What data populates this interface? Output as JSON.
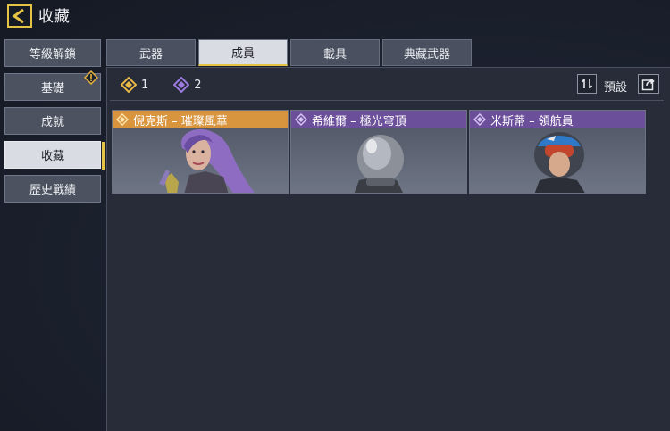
{
  "header": {
    "title": "收藏"
  },
  "sidebar": {
    "items": [
      {
        "label": "等級解鎖"
      },
      {
        "label": "基礎"
      },
      {
        "label": "成就"
      },
      {
        "label": "收藏"
      },
      {
        "label": "歷史戰績"
      }
    ]
  },
  "tabs": [
    {
      "label": "武器"
    },
    {
      "label": "成員"
    },
    {
      "label": "載具"
    },
    {
      "label": "典藏武器"
    }
  ],
  "counters": {
    "gold": {
      "value": "1",
      "color": "#e6b847"
    },
    "purple": {
      "value": "2",
      "color": "#9b7be0"
    }
  },
  "toolbar": {
    "preset_label": "預設"
  },
  "cards": [
    {
      "name": "倪克斯 – 璀璨風華",
      "rarity": "gold",
      "color": "#d9953e"
    },
    {
      "name": "希維爾 – 極光穹頂",
      "rarity": "purple",
      "color": "#6c4f9a"
    },
    {
      "name": "米斯蒂 – 領航員",
      "rarity": "purple",
      "color": "#6c4f9a"
    }
  ]
}
